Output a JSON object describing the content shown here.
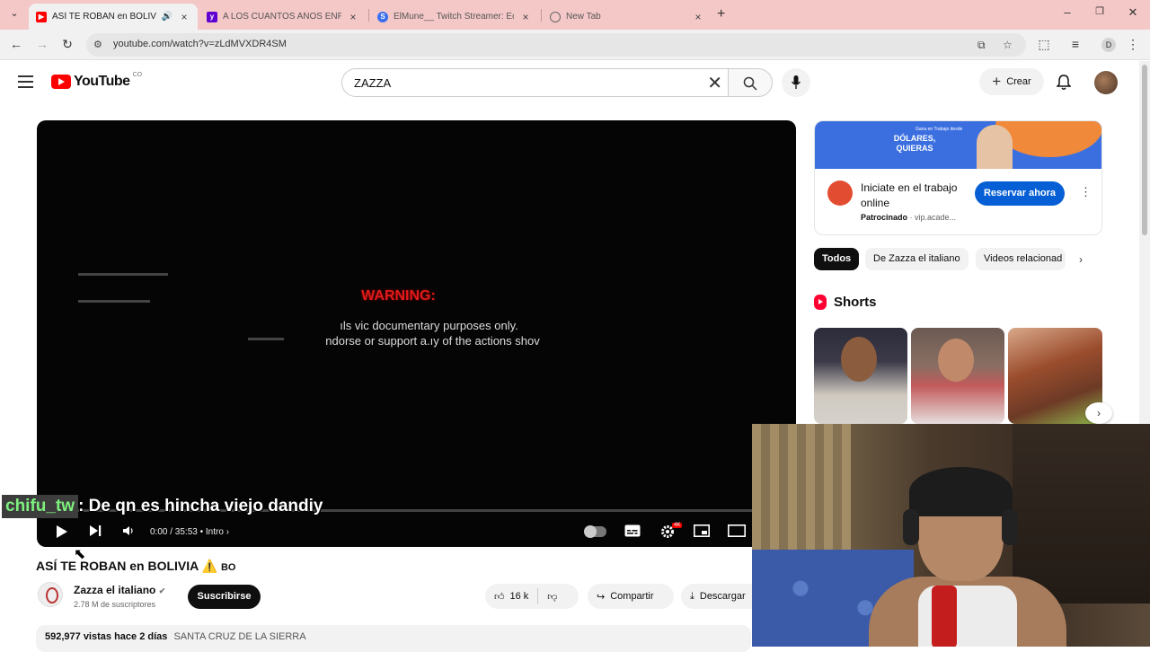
{
  "browser": {
    "tabs": [
      {
        "title": "ASÍ TE ROBAN en BOLIVIA ⚠️",
        "favicon_color": "#ff0000",
        "active": true
      },
      {
        "title": "A LOS CUANTOS AÑOS ENPEZÓ",
        "favicon_color": "#6001d2",
        "active": false
      },
      {
        "title": "ElMune__ Twitch Streamer: Ed",
        "favicon_color": "#3a6ff0",
        "favicon_letter": "S",
        "active": false
      },
      {
        "title": "New Tab",
        "favicon_color": "#666666",
        "active": false
      }
    ],
    "url": "youtube.com/watch?v=zLdMVXDR4SM",
    "profile_initial": "D"
  },
  "youtube": {
    "logo_text": "YouTube",
    "country_code": "CO",
    "search_value": "ZAZZA",
    "create_label": "Crear"
  },
  "player": {
    "warning_title": "WARNING:",
    "warning_line1": "ıls vic      documentary purposes only.",
    "warning_line2": "ndorse or support a.ıy of the actions shov",
    "time": "0:00 / 35:53",
    "chapter": "Intro",
    "quality_badge": "4K"
  },
  "chat_overlay": {
    "user": "chifu_tw",
    "message": " : De qn es hincha viejo dandiy"
  },
  "video": {
    "title": "ASÍ TE ROBAN en BOLIVIA",
    "title_emoji": "⚠️",
    "title_tag": "BO",
    "channel": "Zazza el italiano",
    "subscribers": "2.78 M de suscriptores",
    "subscribe_label": "Suscribirse",
    "likes": "16 k",
    "share_label": "Compartir",
    "download_label": "Descargar",
    "views": "592,977 vistas",
    "age": "hace 2 días",
    "location": "SANTA CRUZ DE LA SIERRA"
  },
  "sidebar": {
    "ad": {
      "banner_small": "Gana en Trabajo desde",
      "banner_big": "DÓLARES, QUIERAS",
      "title": "Iniciate en el trabajo online",
      "sponsored": "Patrocinado",
      "domain": "vip.acade...",
      "cta": "Reservar ahora"
    },
    "chips": [
      "Todos",
      "De Zazza el italiano",
      "Videos relacionad"
    ],
    "shorts_title": "Shorts"
  },
  "colors": {
    "brand_red": "#ff0000",
    "tabbar_bg": "#f5c8c8",
    "cta_blue": "#065fd4",
    "chat_name_green": "#7ef07e"
  }
}
